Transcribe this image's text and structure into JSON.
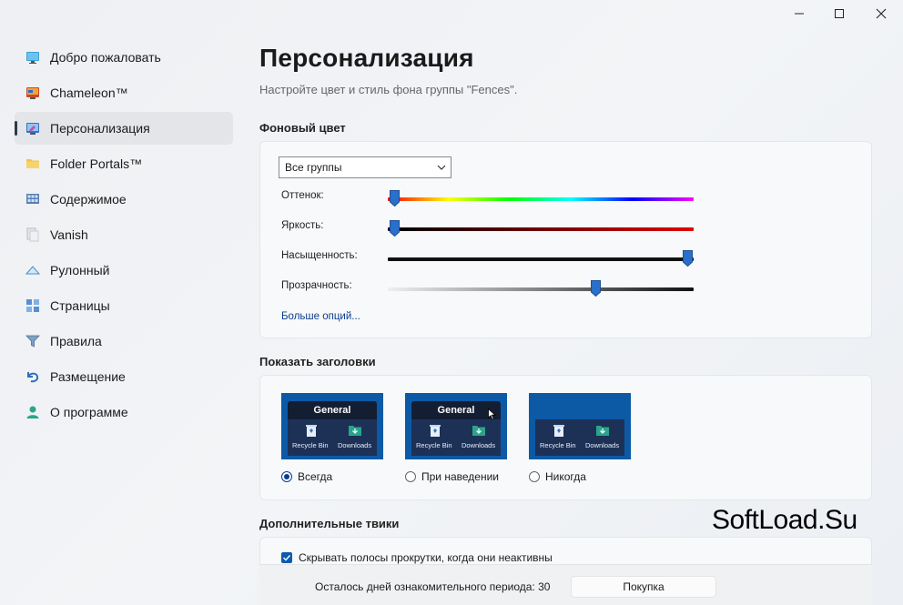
{
  "window_controls": {
    "minimize": "minimize-icon",
    "maximize": "maximize-icon",
    "close": "close-icon"
  },
  "sidebar": {
    "items": [
      {
        "label": "Добро пожаловать",
        "icon": "monitor-icon",
        "active": false
      },
      {
        "label": "Chameleon™",
        "icon": "chameleon-icon",
        "active": false
      },
      {
        "label": "Персонализация",
        "icon": "personalize-icon",
        "active": true
      },
      {
        "label": "Folder Portals™",
        "icon": "folder-icon",
        "active": false
      },
      {
        "label": "Содержимое",
        "icon": "grid-icon",
        "active": false
      },
      {
        "label": "Vanish",
        "icon": "vanish-icon",
        "active": false
      },
      {
        "label": "Рулонный",
        "icon": "rollup-icon",
        "active": false
      },
      {
        "label": "Страницы",
        "icon": "pages-icon",
        "active": false
      },
      {
        "label": "Правила",
        "icon": "filter-icon",
        "active": false
      },
      {
        "label": "Размещение",
        "icon": "undo-icon",
        "active": false
      },
      {
        "label": "О программе",
        "icon": "person-icon",
        "active": false
      }
    ]
  },
  "main": {
    "title": "Персонализация",
    "subtitle": "Настройте цвет и стиль фона группы \"Fences\".",
    "background_color": {
      "section_title": "Фоновый цвет",
      "group_select_value": "Все группы",
      "sliders": [
        {
          "label": "Оттенок:",
          "value_pct": 2
        },
        {
          "label": "Яркость:",
          "value_pct": 2
        },
        {
          "label": "Насыщенность:",
          "value_pct": 98
        },
        {
          "label": "Прозрачность:",
          "value_pct": 68
        }
      ],
      "more_options_link": "Больше опций..."
    },
    "show_titles": {
      "section_title": "Показать заголовки",
      "options": [
        {
          "label": "Всегда",
          "selected": true,
          "preview_title": "General",
          "show_title": true,
          "cursor": false
        },
        {
          "label": "При наведении",
          "selected": false,
          "preview_title": "General",
          "show_title": true,
          "cursor": true
        },
        {
          "label": "Никогда",
          "selected": false,
          "preview_title": "",
          "show_title": false,
          "cursor": false
        }
      ],
      "preview_items": {
        "recycle_bin": "Recycle Bin",
        "downloads": "Downloads"
      }
    },
    "extra_tweaks": {
      "section_title": "Дополнительные твики",
      "checkbox_label": "Скрывать полосы прокрутки, когда они неактивны",
      "checkbox_checked": true
    }
  },
  "footer": {
    "trial_text": "Осталось дней ознакомительного периода: 30",
    "buy_button": "Покупка"
  },
  "watermark": "SoftLoad.Su",
  "colors": {
    "accent": "#0b3d8c",
    "preview_bg": "#0c5aa6",
    "fence": "#1a2a48"
  }
}
